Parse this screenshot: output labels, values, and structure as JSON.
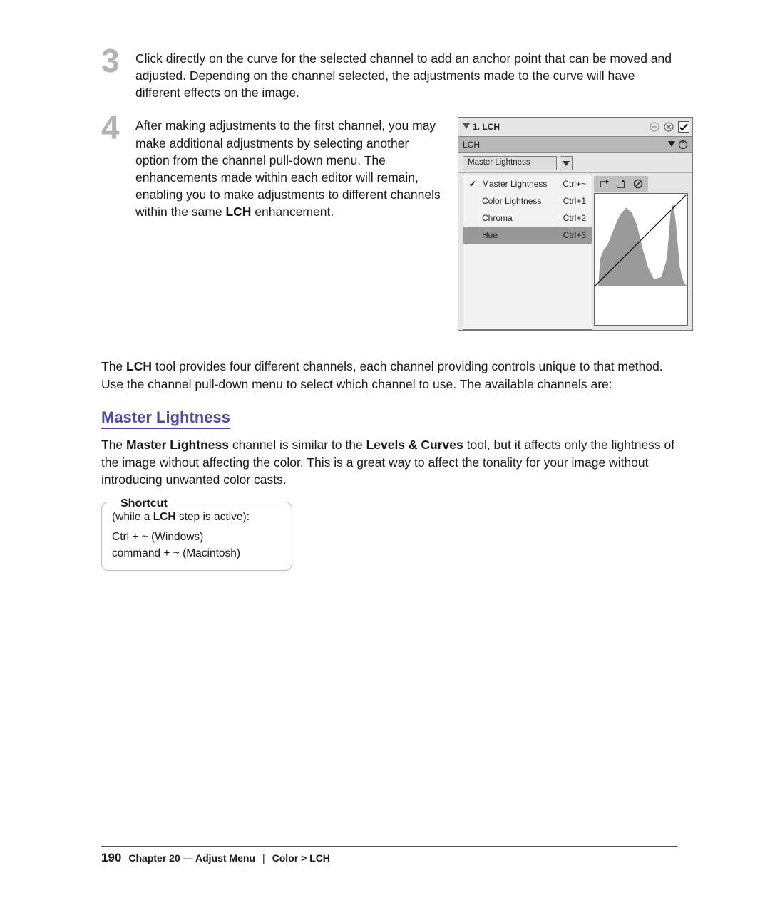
{
  "steps": {
    "3": {
      "num": "3",
      "text": "Click directly on the curve for the selected channel to add an anchor point that can be moved and adjusted. Depending on the channel selected, the adjustments made to the curve will have different effects on the image."
    },
    "4": {
      "num": "4",
      "text_a": "After making adjustments to the first channel, you may make additional adjustments by selecting another option from the channel pull-down menu. The enhancements made within each editor will remain, enabling you to make adjustments to different channels within the same ",
      "text_bold": "LCH",
      "text_b": " enhancement."
    }
  },
  "panel": {
    "title": "1. LCH",
    "bar_label": "LCH",
    "selector_value": "Master Lightness",
    "dropdown": [
      {
        "label": "Master Lightness",
        "shortcut": "Ctrl+~",
        "checked": true,
        "selected": false
      },
      {
        "label": "Color Lightness",
        "shortcut": "Ctrl+1",
        "checked": false,
        "selected": false
      },
      {
        "label": "Chroma",
        "shortcut": "Ctrl+2",
        "checked": false,
        "selected": false
      },
      {
        "label": "Hue",
        "shortcut": "Ctrl+3",
        "checked": false,
        "selected": true
      }
    ]
  },
  "after_panel": {
    "a": "The ",
    "b": "LCH",
    "c": " tool provides four different channels, each channel providing controls unique to that method. Use the channel pull-down menu to select which channel to use. The available channels are:"
  },
  "section": {
    "heading": "Master Lightness",
    "a": "The ",
    "b": "Master Lightness",
    "c": " channel is similar to the ",
    "d": "Levels & Curves",
    "e": " tool, but it affects only the lightness of the image without affecting the color. This is a great way to affect the tonality for your image without introducing unwanted color casts."
  },
  "shortcut": {
    "legend": "Shortcut",
    "line1_a": "(while a ",
    "line1_b": "LCH",
    "line1_c": " step is active):",
    "line2": "Ctrl + ~ (Windows)",
    "line3": "command + ~ (Macintosh)"
  },
  "footer": {
    "page": "190",
    "chapter": "Chapter 20 — Adjust Menu",
    "sep": "|",
    "crumb": "Color > LCH"
  }
}
